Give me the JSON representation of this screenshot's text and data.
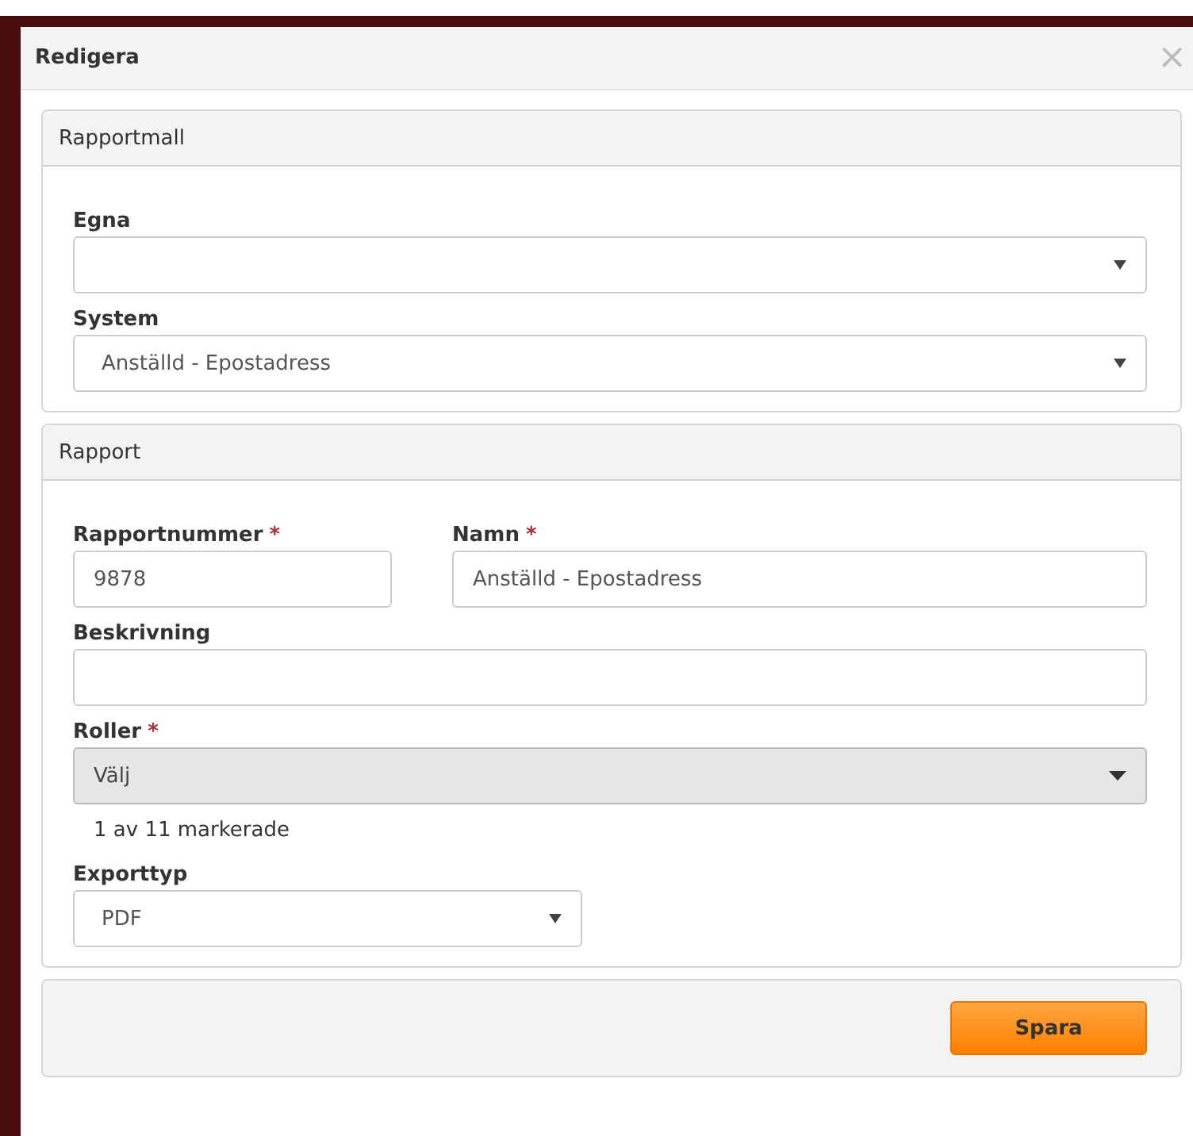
{
  "dialog": {
    "title": "Redigera",
    "close": "×"
  },
  "panels": [
    {
      "title": "Rapportmall",
      "rows": [
        [
          {
            "kind": "select",
            "label": "Egna"
          }
        ],
        [
          {
            "kind": "select",
            "label": "System",
            "value": "Anställd - Epostadress"
          }
        ]
      ]
    },
    {
      "title": "Rapport",
      "rows": [
        [
          {
            "kind": "text",
            "label": "Rapportnummer",
            "required_mark": "*",
            "value": "9878"
          },
          {
            "kind": "text",
            "label": "Namn",
            "required_mark": "*",
            "value": "Anställd - Epostadress"
          }
        ],
        [
          {
            "kind": "text",
            "label": "Beskrivning"
          }
        ],
        [
          {
            "kind": "multiselect",
            "label": "Roller",
            "required_mark": "*",
            "value": "Välj",
            "note": "1 av 11 markerade"
          }
        ],
        [
          {
            "kind": "compact_select",
            "label": "Exporttyp",
            "value": "PDF"
          }
        ]
      ]
    }
  ],
  "footer": {
    "save_button": "Spara"
  }
}
